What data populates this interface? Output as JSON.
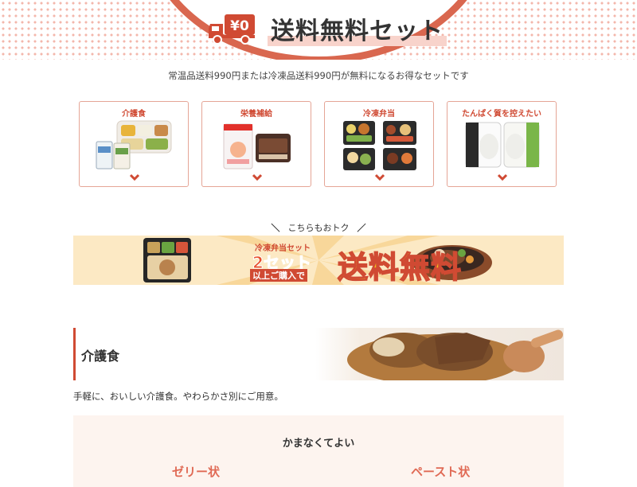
{
  "hero": {
    "title": "送料無料セット",
    "icon_text": "¥0"
  },
  "subtitle": "常温品送料990円または冷凍品送料990円が無料になるお得なセットです",
  "categories": [
    {
      "label": "介護食"
    },
    {
      "label": "栄養補給"
    },
    {
      "label": "冷凍弁当"
    },
    {
      "label": "たんぱく質を控えたい"
    }
  ],
  "deal": {
    "caption": "こちらもおトク",
    "slash_left": "＼",
    "slash_right": "／",
    "banner_sub": "冷凍弁当セット",
    "banner_count": "2セット",
    "banner_buy": "以上ご購入で",
    "banner_big": "送料無料"
  },
  "section": {
    "title": "介護食",
    "description": "手軽に、おいしい介護食。やわらかさ別にご用意。",
    "panel_title": "かまなくてよい",
    "tabs": [
      "ゼリー状",
      "ペースト状"
    ]
  },
  "colors": {
    "accent": "#d04a33",
    "accent_light": "#e5a596",
    "banner_bg": "#fce9c4",
    "panel_bg": "#fdf4ef"
  }
}
